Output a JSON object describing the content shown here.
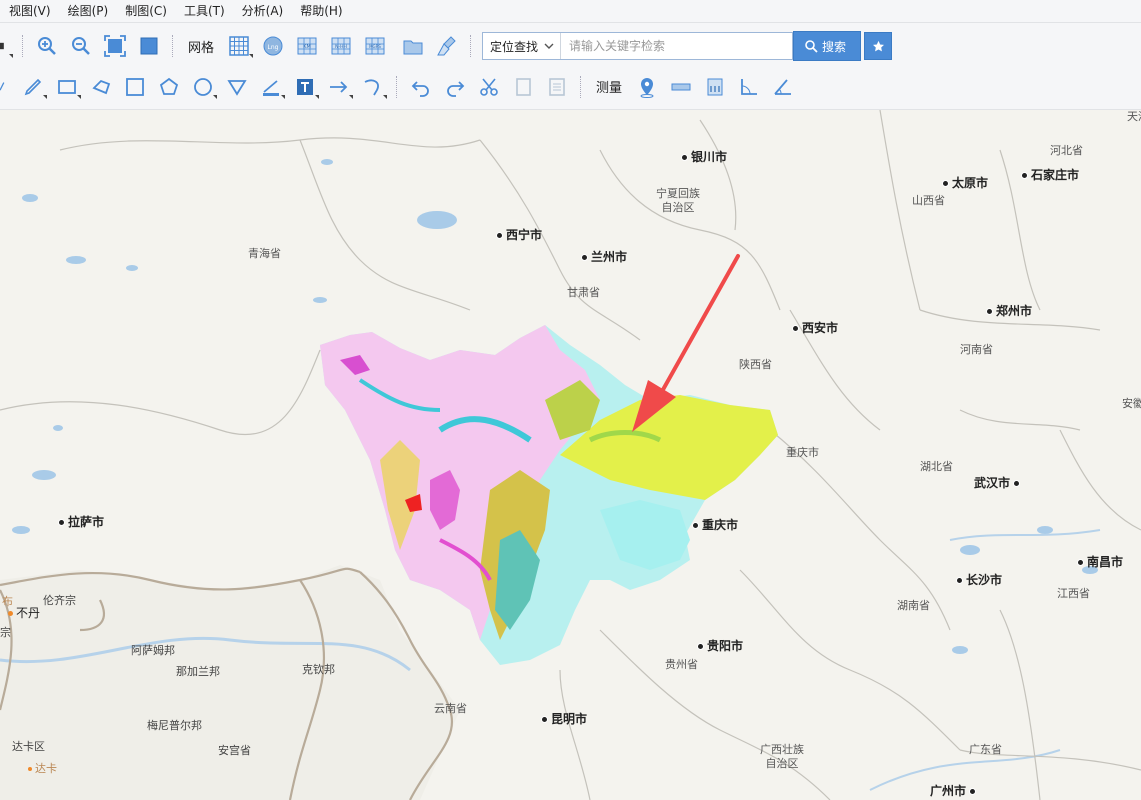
{
  "menu": [
    "视图(V)",
    "绘图(P)",
    "制图(C)",
    "工具(T)",
    "分析(A)",
    "帮助(H)"
  ],
  "toolbar1": {
    "grid_label": "网格",
    "search_type": "定位查找",
    "search_placeholder": "请输入关键字检索",
    "search_button": "搜索",
    "btn_labels": {
      "lng": "Lng",
      "km": "KM",
      "nh": "N-HH",
      "mgrs": "MGRS"
    }
  },
  "toolbar2": {
    "measure_label": "测量"
  },
  "colors": {
    "accent": "#4a8bd6",
    "arrow": "#f04a4a",
    "land": "#f4f3ee",
    "water": "#a9cbe8",
    "border": "#bdbdbd"
  },
  "map": {
    "cities": [
      {
        "id": "yinchuan",
        "name": "银川市"
      },
      {
        "id": "taiyuan",
        "name": "太原市"
      },
      {
        "id": "shijiazhuang",
        "name": "石家庄市"
      },
      {
        "id": "xining",
        "name": "西宁市"
      },
      {
        "id": "lanzhou",
        "name": "兰州市"
      },
      {
        "id": "xian",
        "name": "西安市"
      },
      {
        "id": "zhengzhou",
        "name": "郑州市"
      },
      {
        "id": "lhasa",
        "name": "拉萨市"
      },
      {
        "id": "chongqing",
        "name": "重庆市"
      },
      {
        "id": "wuhan",
        "name": "武汉市"
      },
      {
        "id": "nanchang",
        "name": "南昌市"
      },
      {
        "id": "changsha",
        "name": "长沙市"
      },
      {
        "id": "guiyang",
        "name": "贵阳市"
      },
      {
        "id": "kunming",
        "name": "昆明市"
      },
      {
        "id": "guangzhou",
        "name": "广州市"
      }
    ],
    "regions": [
      {
        "id": "hebei",
        "name": "河北省"
      },
      {
        "id": "shanxi",
        "name": "山西省"
      },
      {
        "id": "qinghai",
        "name": "青海省"
      },
      {
        "id": "gansu",
        "name": "甘肃省"
      },
      {
        "id": "ningxia",
        "name": "宁夏回族\n自治区"
      },
      {
        "id": "shaanxi",
        "name": "陕西省"
      },
      {
        "id": "henan",
        "name": "河南省"
      },
      {
        "id": "chongqing-prov",
        "name": "重庆市"
      },
      {
        "id": "hubei",
        "name": "湖北省"
      },
      {
        "id": "hunan",
        "name": "湖南省"
      },
      {
        "id": "jiangxi",
        "name": "江西省"
      },
      {
        "id": "guizhou",
        "name": "贵州省"
      },
      {
        "id": "yunnan",
        "name": "云南省"
      },
      {
        "id": "guangxi",
        "name": "广西壮族\n自治区"
      },
      {
        "id": "guangdong",
        "name": "广东省"
      },
      {
        "id": "anhui",
        "name": "安徽"
      },
      {
        "id": "tianjin",
        "name": "天津"
      }
    ],
    "foreign": [
      {
        "id": "bhutan",
        "name": "不丹"
      },
      {
        "id": "lunqizong",
        "name": "伦齐宗"
      },
      {
        "id": "assam",
        "name": "阿萨姆邦"
      },
      {
        "id": "nagaland",
        "name": "那加兰邦"
      },
      {
        "id": "kachin",
        "name": "克钦邦"
      },
      {
        "id": "meghalaya",
        "name": "梅尼普尔邦"
      },
      {
        "id": "dhaka-div",
        "name": "达卡区"
      },
      {
        "id": "dhaka",
        "name": "达卡"
      },
      {
        "id": "anwei",
        "name": "安宫省"
      },
      {
        "id": "bu",
        "name": "布"
      },
      {
        "id": "zong",
        "name": "宗"
      }
    ]
  }
}
